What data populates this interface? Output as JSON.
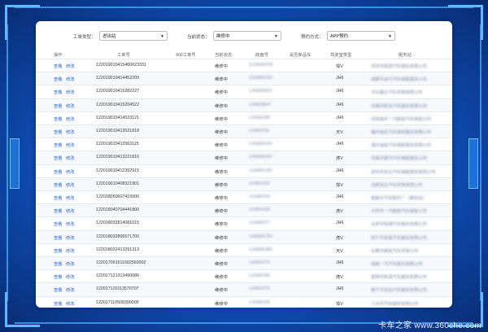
{
  "filters": {
    "type_label": "工单类型：",
    "type_value": "进出站",
    "status_label": "当前状态：",
    "status_value": "维修中",
    "appt_label": "预约方式：",
    "appt_value": "APP预约"
  },
  "columns": [
    "操作",
    "工单号",
    "400工单号",
    "当前状态",
    "底盘号",
    "是否新品车",
    "驾驶室类型",
    "服务站"
  ],
  "row_actions": {
    "view": "查看",
    "edit": "修改"
  },
  "rows": [
    {
      "order": "122019010415400623331",
      "status": "维修中",
      "cab": "悍V",
      "chassis": "LG3A5K0V8",
      "station": "深圳市恒源汽车服务有限公司"
    },
    {
      "order": "122019010414452209",
      "status": "维修中",
      "cab": "JH6",
      "chassis": "LG0A6K24V",
      "station": "成都市远行汽车销售服务公司"
    },
    {
      "order": "122019010415282227",
      "status": "维修中",
      "cab": "JH6",
      "chassis": "LH0A0K92V",
      "station": "河北盛达汽车贸易有限公司"
    },
    {
      "order": "122019010415204522",
      "status": "维修中",
      "cab": "JH6",
      "chassis": "LH3K0W47",
      "station": "无锡市新亚汽车服务有限公司"
    },
    {
      "order": "122019010414533121",
      "status": "维修中",
      "cab": "JH6",
      "chassis": "LG0A0V89",
      "station": "沈阳瑞丰一汽解放汽车销售公司"
    },
    {
      "order": "122019010413531818",
      "status": "维修中",
      "cab": "天V",
      "chassis": "LH3K0V0L",
      "station": "福州信宏汽车维修服务有限公司"
    },
    {
      "order": "122019010412563115",
      "status": "维修中",
      "cab": "JH6",
      "chassis": "LG0A6K03V",
      "station": "温州诚信汽车销售服务有限公司"
    },
    {
      "order": "122019010413221816",
      "status": "维修中",
      "cab": "虎V",
      "chassis": "LH0A0K43V",
      "station": "济南市重汽汽车销售服务公司"
    },
    {
      "order": "122019010412392915",
      "status": "维修中",
      "cab": "JH6",
      "chassis": "LG0A6K18V",
      "station": "郑州市宏达汽车销售服务有限公司"
    },
    {
      "order": "122019010408321901",
      "status": "维修中",
      "cab": "悍V",
      "chassis": "LH3K0V29",
      "station": "合肥安达汽车贸易有限公司"
    },
    {
      "order": "122018050607415000",
      "status": "维修中",
      "cab": "JH6",
      "chassis": "LG0A0V54",
      "station": "南昌市汽车配件厂（服务站）"
    },
    {
      "order": "122018040704441800",
      "status": "维修中",
      "cab": "虎V",
      "chassis": "LH3K0V28",
      "station": "大同市一汽解放汽车销售公司"
    },
    {
      "order": "122018032814081015",
      "status": "维修中",
      "cab": "JH6",
      "chassis": "LG0A0V27",
      "station": "太原市恒通汽车服务有限公司"
    },
    {
      "order": "122018032806571700",
      "status": "维修中",
      "cab": "虎V",
      "chassis": "LH0A0K75V",
      "station": "西宁市安泰汽车服务有限公司"
    },
    {
      "order": "122018032413291313",
      "status": "维修中",
      "cab": "天V",
      "chassis": "LG0A6K38V",
      "station": "长春市解放汽车贸易公司"
    },
    {
      "order": "122017061511502560002",
      "status": "维修中",
      "cab": "JH6",
      "chassis": "LH3K0V70",
      "station": "湖南一汽汽车服务有限公司"
    },
    {
      "order": "122017121313490086",
      "status": "维修中",
      "cab": "虎V",
      "chassis": "LG0A0V65",
      "station": "昆明市新源汽车服务有限公司"
    },
    {
      "order": "122017120113570707",
      "status": "维修中",
      "cab": "JH6",
      "chassis": "LH3K0V70",
      "station": "南宁市宏远汽车服务有限公司"
    },
    {
      "order": "122017110508390009",
      "status": "维修中",
      "cab": "悍V",
      "chassis": "LG0A0V09",
      "station": "兰州市汽车服务有限公司"
    }
  ],
  "watermark": "卡车之家 www.360che.com"
}
